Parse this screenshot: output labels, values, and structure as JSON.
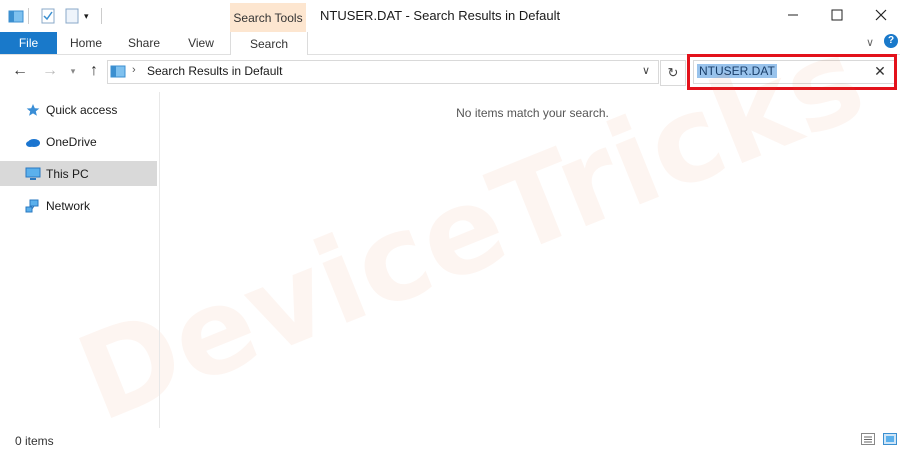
{
  "window": {
    "title": "NTUSER.DAT - Search Results in Default",
    "contextual_group": "Search Tools"
  },
  "ribbon": {
    "tabs": [
      {
        "label": "File"
      },
      {
        "label": "Home"
      },
      {
        "label": "Share"
      },
      {
        "label": "View"
      },
      {
        "label": "Search"
      }
    ]
  },
  "address": {
    "path": "Search Results in Default"
  },
  "search": {
    "value": "NTUSER.DAT"
  },
  "nav": {
    "items": [
      {
        "label": "Quick access",
        "icon": "star-icon"
      },
      {
        "label": "OneDrive",
        "icon": "cloud-icon"
      },
      {
        "label": "This PC",
        "icon": "monitor-icon",
        "selected": true
      },
      {
        "label": "Network",
        "icon": "network-icon"
      }
    ]
  },
  "content": {
    "empty_message": "No items match your search."
  },
  "status": {
    "item_count": "0 items"
  },
  "watermark": "DeviceTricks",
  "colors": {
    "file_tab": "#1979ca",
    "contextual_tab": "#fde6d0",
    "highlight_box": "#e3121b",
    "selection": "#99c3ec"
  }
}
